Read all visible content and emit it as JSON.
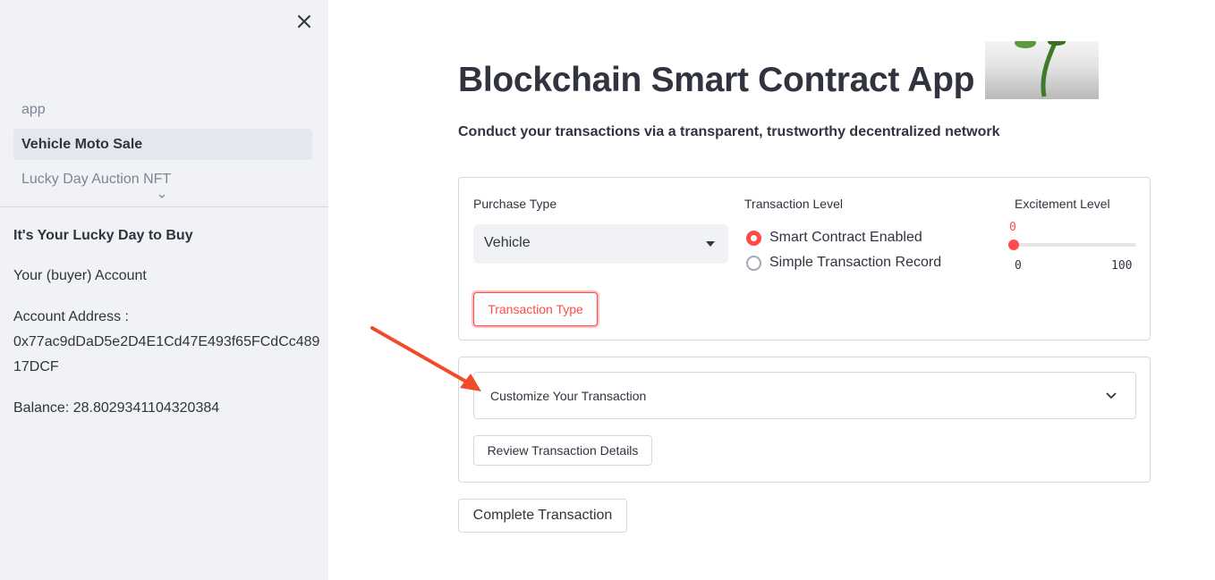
{
  "sidebar": {
    "nav_items": [
      {
        "label": "app",
        "active": false
      },
      {
        "label": "Vehicle Moto Sale",
        "active": true
      },
      {
        "label": "Lucky Day Auction NFT",
        "active": false
      }
    ],
    "heading": "It's Your Lucky Day to Buy",
    "account_label": "Your (buyer) Account",
    "address_label": "Account Address :",
    "address_line1": "0x77ac9dDaD5e2D4E1Cd47E493f65FCdCc489",
    "address_line2": "17DCF",
    "balance": "Balance: 28.8029341104320384"
  },
  "main": {
    "title": "Blockchain Smart Contract App",
    "subtitle": "Conduct your transactions via a transparent, trustworthy decentralized network",
    "purchase_type": {
      "label": "Purchase Type",
      "value": "Vehicle"
    },
    "transaction_level": {
      "label": "Transaction Level",
      "options": [
        "Smart Contract Enabled",
        "Simple Transaction Record"
      ],
      "selected": "Smart Contract Enabled"
    },
    "excitement_level": {
      "label": "Excitement Level",
      "value": "0",
      "min": "0",
      "max": "100"
    },
    "transaction_type_button": "Transaction Type",
    "expander_label": "Customize Your Transaction",
    "review_button": "Review Transaction Details",
    "complete_button": "Complete Transaction"
  },
  "colors": {
    "accent": "#ff4b4b",
    "sidebar_bg": "#f0f2f6",
    "text": "#31333f",
    "annotation_arrow": "#f04a2a"
  },
  "icons": [
    "close-icon",
    "chevron-down-icon",
    "caret-down-icon",
    "annotation-arrow-icon"
  ]
}
